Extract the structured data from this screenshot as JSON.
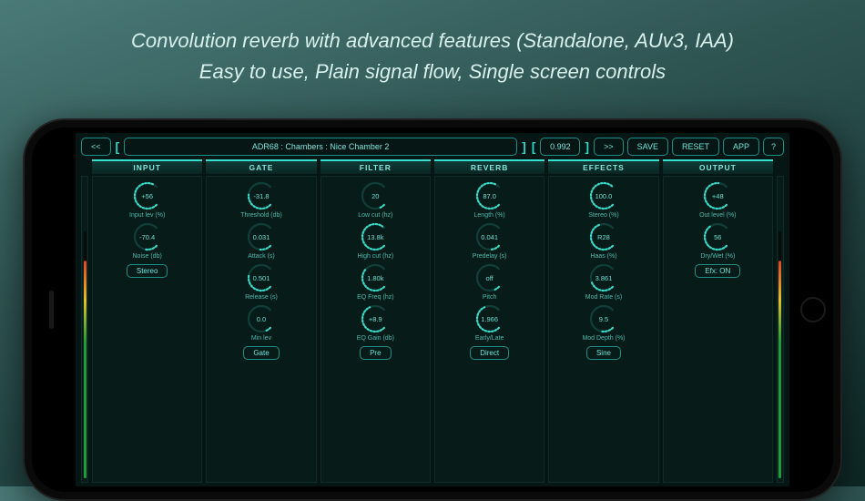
{
  "promo": {
    "line1": "Convolution reverb with advanced features (Standalone, AUv3, IAA)",
    "line2": "Easy to use, Plain signal flow, Single screen controls"
  },
  "topbar": {
    "prev": "<<",
    "preset": "ADR68 : Chambers : Nice Chamber 2",
    "length": "0.992",
    "next": ">>",
    "save": "SAVE",
    "reset": "RESET",
    "app": "APP",
    "help": "?"
  },
  "columns": {
    "input": {
      "title": "INPUT",
      "knobs": [
        {
          "value": "+56",
          "label": "Input lev (%)",
          "angle": 250
        },
        {
          "value": "-70.4",
          "label": "Noise (db)",
          "angle": 60
        }
      ],
      "button": "Stereo"
    },
    "gate": {
      "title": "GATE",
      "knobs": [
        {
          "value": "-31.8",
          "label": "Threshold (db)",
          "angle": 140
        },
        {
          "value": "0.031",
          "label": "Attack (s)",
          "angle": 50
        },
        {
          "value": "0.501",
          "label": "Release (s)",
          "angle": 150
        },
        {
          "value": "0.0",
          "label": "Min lev",
          "angle": 30
        }
      ],
      "button": "Gate"
    },
    "filter": {
      "title": "FILTER",
      "knobs": [
        {
          "value": "20",
          "label": "Low cut (hz)",
          "angle": 30
        },
        {
          "value": "13.8k",
          "label": "High cut (hz)",
          "angle": 260
        },
        {
          "value": "1.80k",
          "label": "EQ Freq (hz)",
          "angle": 180
        },
        {
          "value": "+8.9",
          "label": "EQ Gain (db)",
          "angle": 200
        }
      ],
      "button": "Pre"
    },
    "reverb": {
      "title": "REVERB",
      "knobs": [
        {
          "value": "87.0",
          "label": "Length (%)",
          "angle": 250
        },
        {
          "value": "0.041",
          "label": "Predelay (s)",
          "angle": 40
        },
        {
          "value": "off",
          "label": "Pitch",
          "angle": 30
        },
        {
          "value": "1.966",
          "label": "Early/Late",
          "angle": 200
        }
      ],
      "button": "Direct"
    },
    "effects": {
      "title": "EFFECTS",
      "knobs": [
        {
          "value": "100.0",
          "label": "Stereo (%)",
          "angle": 290
        },
        {
          "value": "R28",
          "label": "Haas (%)",
          "angle": 210
        },
        {
          "value": "3.861",
          "label": "Mod Rate (s)",
          "angle": 120
        },
        {
          "value": "9.5",
          "label": "Mod Depth (%)",
          "angle": 60
        }
      ],
      "button": "Sine"
    },
    "output": {
      "title": "OUTPUT",
      "knobs": [
        {
          "value": "+48",
          "label": "Out level (%)",
          "angle": 230
        },
        {
          "value": "56",
          "label": "Dry/Wet (%)",
          "angle": 190
        }
      ],
      "button": "Efx: ON"
    }
  }
}
